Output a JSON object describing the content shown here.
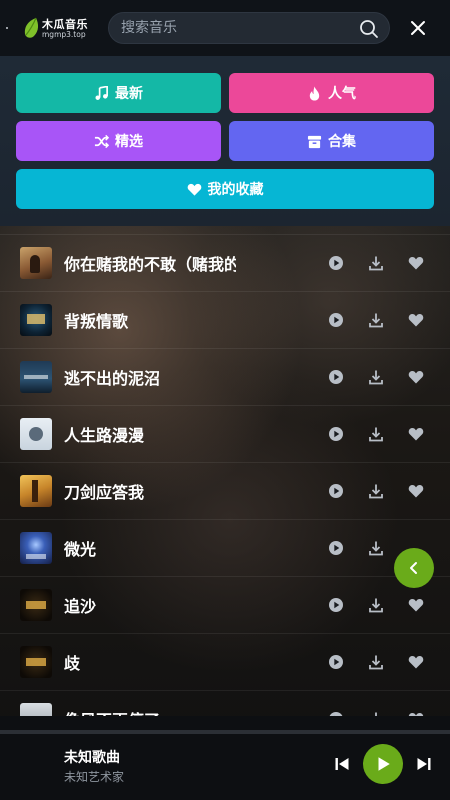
{
  "header": {
    "logo_name": "木瓜音乐",
    "logo_domain": "mgmp3.top",
    "search_placeholder": "搜索音乐",
    "search_icon": "search-icon",
    "close_icon": "close-icon"
  },
  "categories": [
    {
      "label": "最新",
      "icon": "music-note-icon",
      "color": "#14b8a6"
    },
    {
      "label": "人气",
      "icon": "fire-icon",
      "color": "#ec4899"
    },
    {
      "label": "精选",
      "icon": "shuffle-icon",
      "color": "#a855f7"
    },
    {
      "label": "合集",
      "icon": "box-icon",
      "color": "#6366f1"
    },
    {
      "label": "我的收藏",
      "icon": "heart-icon",
      "color": "#06b6d4"
    }
  ],
  "songs": [
    {
      "title": "你在赌我的不敢（赌我的"
    },
    {
      "title": "背叛情歌"
    },
    {
      "title": "逃不出的泥沼"
    },
    {
      "title": "人生路漫漫"
    },
    {
      "title": "刀剑应答我"
    },
    {
      "title": "微光"
    },
    {
      "title": "追沙"
    },
    {
      "title": "歧"
    },
    {
      "title": "像风不再停了"
    }
  ],
  "row_actions": [
    "play-icon",
    "download-icon",
    "heart-icon"
  ],
  "player": {
    "title": "未知歌曲",
    "artist": "未知艺术家",
    "progress": 0,
    "accent": "#6aab1a"
  }
}
